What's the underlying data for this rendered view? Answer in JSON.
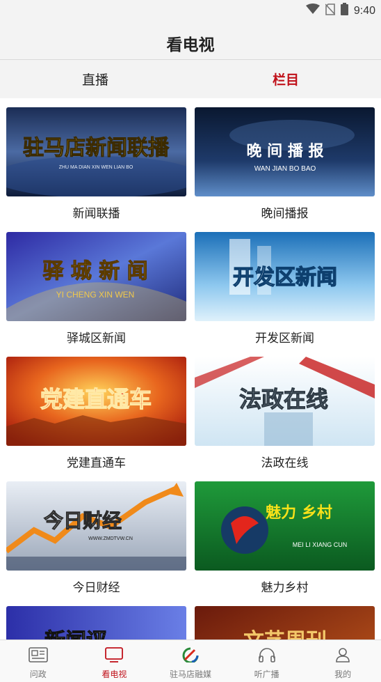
{
  "status_bar": {
    "time": "9:40"
  },
  "header": {
    "title": "看电视"
  },
  "tabs": [
    {
      "label": "直播",
      "active": false
    },
    {
      "label": "栏目",
      "active": true
    }
  ],
  "accent_color": "#c0111a",
  "programs": [
    {
      "name": "新闻联播",
      "thumb_title": "驻马店新闻联播",
      "thumb_subtitle": "ZHU MA DIAN XIN WEN LIAN BO"
    },
    {
      "name": "晚间播报",
      "thumb_title": "晚 间 播 报",
      "thumb_subtitle": "WAN JIAN BO BAO"
    },
    {
      "name": "驿城区新闻",
      "thumb_title": "驿 城 新 闻",
      "thumb_subtitle": "YI CHENG XIN WEN"
    },
    {
      "name": "开发区新闻",
      "thumb_title": "开发区新闻",
      "thumb_subtitle": ""
    },
    {
      "name": "党建直通车",
      "thumb_title": "党建直通车",
      "thumb_subtitle": ""
    },
    {
      "name": "法政在线",
      "thumb_title": "法政在线",
      "thumb_subtitle": ""
    },
    {
      "name": "今日财经",
      "thumb_title": "今日财经",
      "thumb_subtitle": "WWW.ZMDTVW.CN"
    },
    {
      "name": "魅力乡村",
      "thumb_title": "魅力  乡村",
      "thumb_subtitle": "MEI LI XIANG CUN"
    },
    {
      "name": "",
      "thumb_title": "新闻评",
      "thumb_subtitle": ""
    },
    {
      "name": "",
      "thumb_title": "文艺周刊",
      "thumb_subtitle": ""
    }
  ],
  "bottom_nav": [
    {
      "label": "问政",
      "icon": "news-icon",
      "active": false
    },
    {
      "label": "看电视",
      "icon": "tv-icon",
      "active": true
    },
    {
      "label": "驻马店融媒",
      "icon": "brand-logo-icon",
      "active": false
    },
    {
      "label": "听广播",
      "icon": "headphones-icon",
      "active": false
    },
    {
      "label": "我的",
      "icon": "user-icon",
      "active": false
    }
  ]
}
